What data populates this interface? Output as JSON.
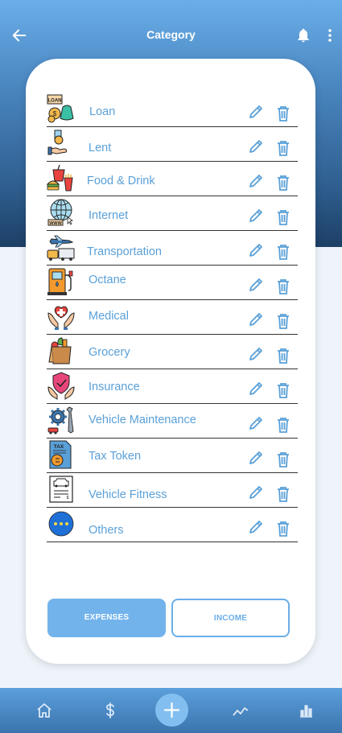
{
  "header": {
    "title": "Category"
  },
  "categories": [
    {
      "label": "Loan",
      "icon": "loan-money-bag-icon"
    },
    {
      "label": "Lent",
      "icon": "lent-hand-coin-icon"
    },
    {
      "label": "Food & Drink",
      "icon": "food-drink-icon"
    },
    {
      "label": "Internet",
      "icon": "internet-globe-icon"
    },
    {
      "label": "Transportation",
      "icon": "transportation-icon"
    },
    {
      "label": "Octane",
      "icon": "fuel-pump-icon"
    },
    {
      "label": "Medical",
      "icon": "medical-hands-heart-icon"
    },
    {
      "label": "Grocery",
      "icon": "grocery-bag-icon"
    },
    {
      "label": "Insurance",
      "icon": "insurance-shield-icon"
    },
    {
      "label": "Vehicle Maintenance",
      "icon": "vehicle-maintenance-gear-icon"
    },
    {
      "label": "Tax Token",
      "icon": "tax-token-document-icon"
    },
    {
      "label": "Vehicle Fitness",
      "icon": "vehicle-fitness-document-icon"
    },
    {
      "label": "Others",
      "icon": "others-dots-icon"
    }
  ],
  "actions": {
    "edit_icon": "pencil-icon",
    "delete_icon": "trash-icon"
  },
  "tabs": {
    "expenses_label": "EXPENSES",
    "income_label": "INCOME",
    "active": "expenses"
  },
  "bottom_nav": [
    "home-icon",
    "dollar-icon",
    "add-icon",
    "trend-chart-icon",
    "bar-chart-icon"
  ],
  "colors": {
    "accent": "#6aaee8",
    "label": "#5aa0d8",
    "header_dark": "#1d3f66"
  }
}
